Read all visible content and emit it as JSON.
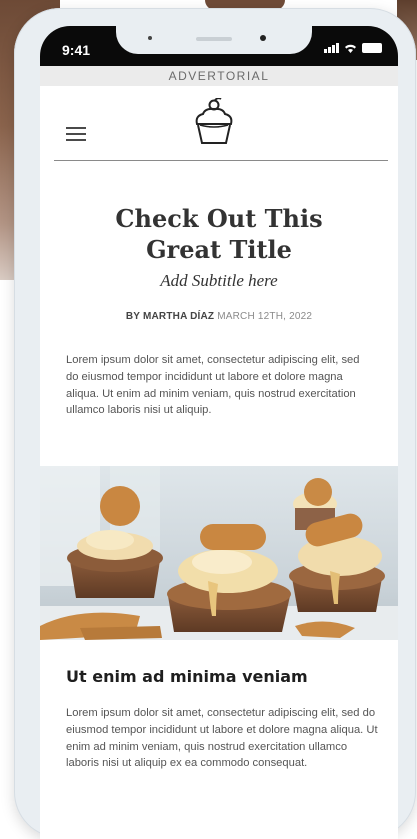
{
  "status_bar": {
    "time": "9:41"
  },
  "ad_label": "ADVERTORIAL",
  "article": {
    "title_line1": "Check Out This",
    "title_line2": "Great Title",
    "subtitle": "Add Subtitle here",
    "author": "BY MARTHA DÍAZ",
    "date": "MARCH 12TH, 2022",
    "intro": "Lorem ipsum dolor sit amet, consectetur adipiscing elit, sed do eiusmod tempor incididunt ut labore et dolore magna aliqua. Ut enim ad minim veniam, quis nostrud exercitation ullamco laboris nisi ut aliquip.",
    "section_heading": "Ut enim ad minima veniam",
    "section_body": "Lorem ipsum dolor sit amet, consectetur adipiscing elit, sed do eiusmod tempor incididunt ut labore et dolore magna aliqua. Ut enim ad minim veniam, quis nostrud exercitation ullamco laboris nisi ut aliquip ex ea commodo consequat."
  },
  "icons": {
    "menu": "hamburger-menu-icon",
    "logo": "cupcake-logo-icon",
    "signal": "cellular-signal-icon",
    "wifi": "wifi-icon",
    "battery": "battery-icon"
  },
  "colors": {
    "status_bar": "#0a0a0a",
    "ad_bar": "#ebebeb",
    "title": "#333333",
    "body_text": "#555555"
  }
}
